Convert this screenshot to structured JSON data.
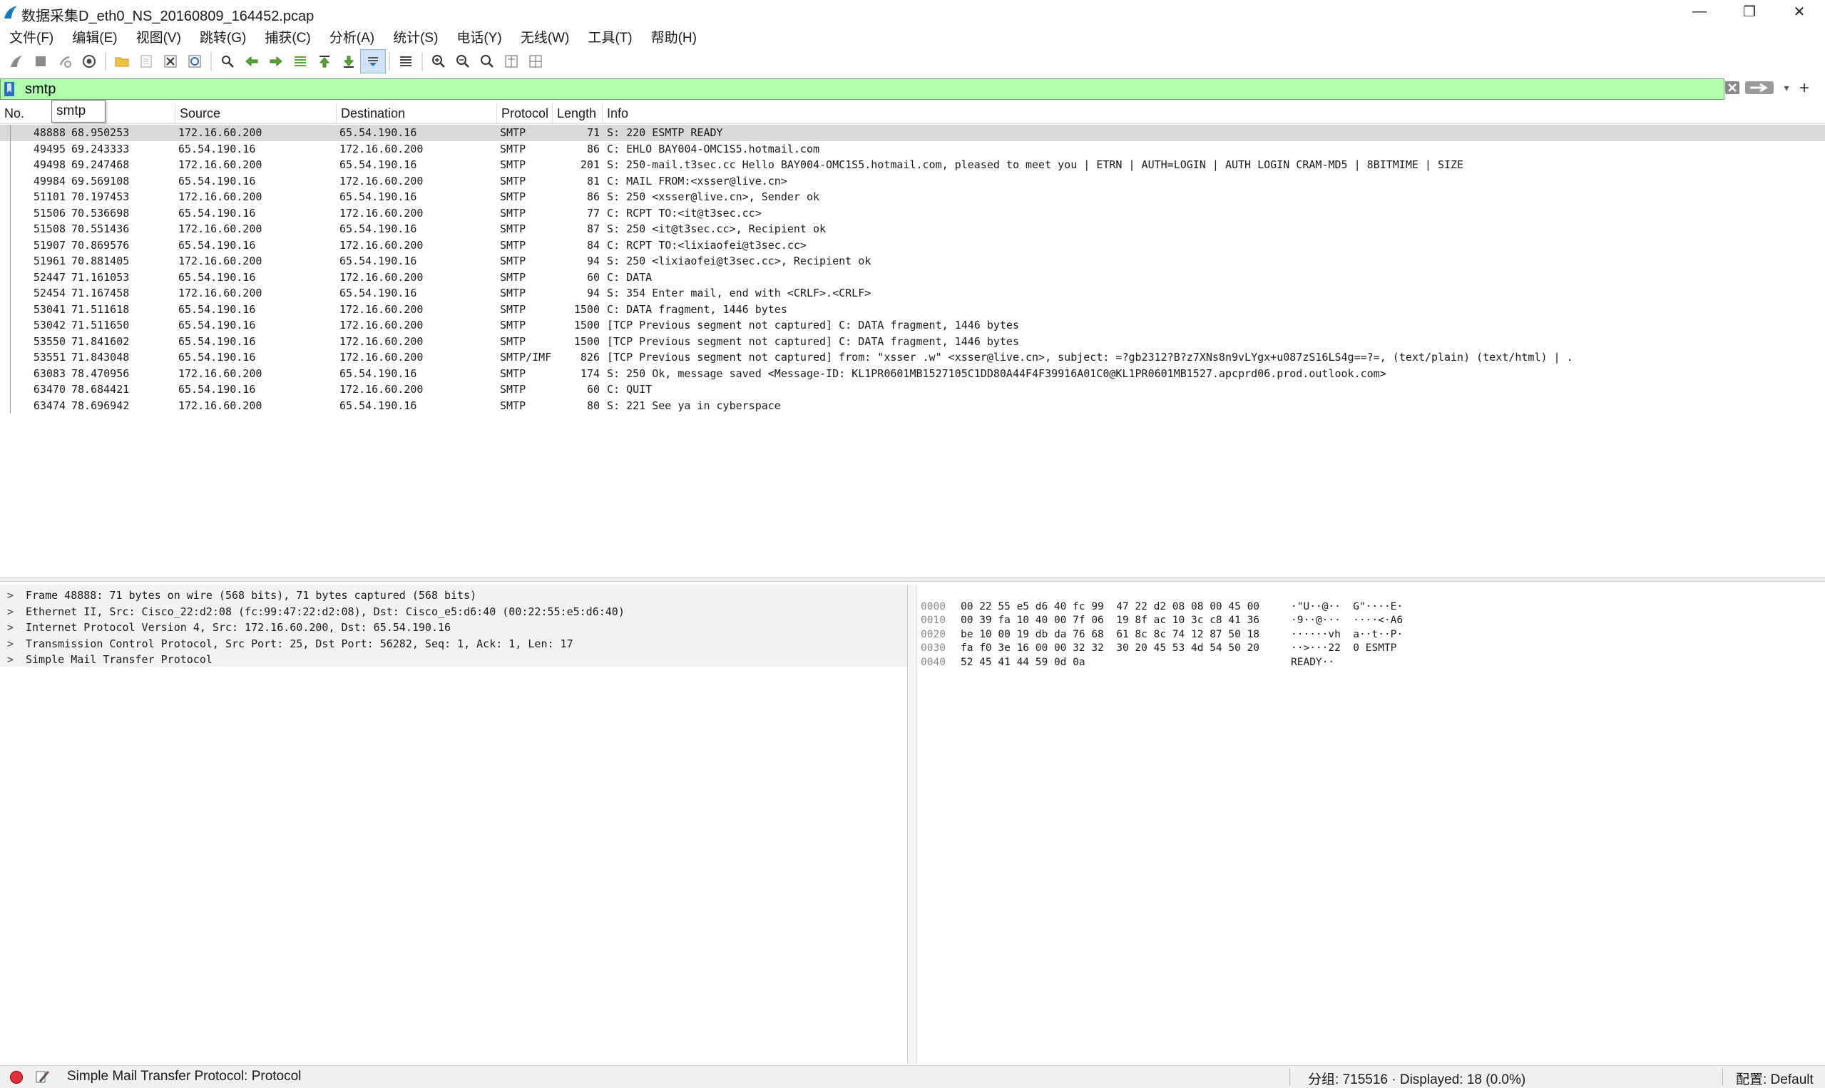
{
  "window": {
    "title": "数据采集D_eth0_NS_20160809_164452.pcap",
    "minimize": "—",
    "maximize": "❐",
    "close": "✕"
  },
  "menu": [
    "文件(F)",
    "编辑(E)",
    "视图(V)",
    "跳转(G)",
    "捕获(C)",
    "分析(A)",
    "统计(S)",
    "电话(Y)",
    "无线(W)",
    "工具(T)",
    "帮助(H)"
  ],
  "filter": {
    "value": "smtp",
    "autocomplete": "smtp",
    "add": "+",
    "dropdown": "▾"
  },
  "columns": [
    "No.",
    "Time",
    "Source",
    "Destination",
    "Protocol",
    "Length",
    "Info"
  ],
  "packets": [
    {
      "no": "48888",
      "time": "68.950253",
      "src": "172.16.60.200",
      "dst": "65.54.190.16",
      "proto": "SMTP",
      "len": "71",
      "info": "S: 220 ESMTP READY"
    },
    {
      "no": "49495",
      "time": "69.243333",
      "src": "65.54.190.16",
      "dst": "172.16.60.200",
      "proto": "SMTP",
      "len": "86",
      "info": "C: EHLO BAY004-OMC1S5.hotmail.com"
    },
    {
      "no": "49498",
      "time": "69.247468",
      "src": "172.16.60.200",
      "dst": "65.54.190.16",
      "proto": "SMTP",
      "len": "201",
      "info": "S: 250-mail.t3sec.cc Hello BAY004-OMC1S5.hotmail.com, pleased to meet you | ETRN | AUTH=LOGIN | AUTH LOGIN CRAM-MD5 | 8BITMIME | SIZE"
    },
    {
      "no": "49984",
      "time": "69.569108",
      "src": "65.54.190.16",
      "dst": "172.16.60.200",
      "proto": "SMTP",
      "len": "81",
      "info": "C: MAIL FROM:<xsser@live.cn>"
    },
    {
      "no": "51101",
      "time": "70.197453",
      "src": "172.16.60.200",
      "dst": "65.54.190.16",
      "proto": "SMTP",
      "len": "86",
      "info": "S: 250 <xsser@live.cn>, Sender ok"
    },
    {
      "no": "51506",
      "time": "70.536698",
      "src": "65.54.190.16",
      "dst": "172.16.60.200",
      "proto": "SMTP",
      "len": "77",
      "info": "C: RCPT TO:<it@t3sec.cc>"
    },
    {
      "no": "51508",
      "time": "70.551436",
      "src": "172.16.60.200",
      "dst": "65.54.190.16",
      "proto": "SMTP",
      "len": "87",
      "info": "S: 250 <it@t3sec.cc>, Recipient ok"
    },
    {
      "no": "51907",
      "time": "70.869576",
      "src": "65.54.190.16",
      "dst": "172.16.60.200",
      "proto": "SMTP",
      "len": "84",
      "info": "C: RCPT TO:<lixiaofei@t3sec.cc>"
    },
    {
      "no": "51961",
      "time": "70.881405",
      "src": "172.16.60.200",
      "dst": "65.54.190.16",
      "proto": "SMTP",
      "len": "94",
      "info": "S: 250 <lixiaofei@t3sec.cc>, Recipient ok"
    },
    {
      "no": "52447",
      "time": "71.161053",
      "src": "65.54.190.16",
      "dst": "172.16.60.200",
      "proto": "SMTP",
      "len": "60",
      "info": "C: DATA"
    },
    {
      "no": "52454",
      "time": "71.167458",
      "src": "172.16.60.200",
      "dst": "65.54.190.16",
      "proto": "SMTP",
      "len": "94",
      "info": "S: 354 Enter mail, end with <CRLF>.<CRLF>"
    },
    {
      "no": "53041",
      "time": "71.511618",
      "src": "65.54.190.16",
      "dst": "172.16.60.200",
      "proto": "SMTP",
      "len": "1500",
      "info": "C: DATA fragment, 1446 bytes"
    },
    {
      "no": "53042",
      "time": "71.511650",
      "src": "65.54.190.16",
      "dst": "172.16.60.200",
      "proto": "SMTP",
      "len": "1500",
      "info": "[TCP Previous segment not captured] C: DATA fragment, 1446 bytes"
    },
    {
      "no": "53550",
      "time": "71.841602",
      "src": "65.54.190.16",
      "dst": "172.16.60.200",
      "proto": "SMTP",
      "len": "1500",
      "info": "[TCP Previous segment not captured] C: DATA fragment, 1446 bytes"
    },
    {
      "no": "53551",
      "time": "71.843048",
      "src": "65.54.190.16",
      "dst": "172.16.60.200",
      "proto": "SMTP/IMF",
      "len": "826",
      "info": "[TCP Previous segment not captured] from: \"xsser .w\" <xsser@live.cn>, subject: =?gb2312?B?z7XNs8n9vLYgx+u087zS16LS4g==?=,  (text/plain) (text/html) | ."
    },
    {
      "no": "63083",
      "time": "78.470956",
      "src": "172.16.60.200",
      "dst": "65.54.190.16",
      "proto": "SMTP",
      "len": "174",
      "info": "S: 250 Ok, message saved <Message-ID: KL1PR0601MB1527105C1DD80A44F4F39916A01C0@KL1PR0601MB1527.apcprd06.prod.outlook.com>"
    },
    {
      "no": "63470",
      "time": "78.684421",
      "src": "65.54.190.16",
      "dst": "172.16.60.200",
      "proto": "SMTP",
      "len": "60",
      "info": "C: QUIT"
    },
    {
      "no": "63474",
      "time": "78.696942",
      "src": "172.16.60.200",
      "dst": "65.54.190.16",
      "proto": "SMTP",
      "len": "80",
      "info": "S: 221 See ya in cyberspace"
    }
  ],
  "details": [
    "Frame 48888: 71 bytes on wire (568 bits), 71 bytes captured (568 bits)",
    "Ethernet II, Src: Cisco_22:d2:08 (fc:99:47:22:d2:08), Dst: Cisco_e5:d6:40 (00:22:55:e5:d6:40)",
    "Internet Protocol Version 4, Src: 172.16.60.200, Dst: 65.54.190.16",
    "Transmission Control Protocol, Src Port: 25, Dst Port: 56282, Seq: 1, Ack: 1, Len: 17",
    "Simple Mail Transfer Protocol"
  ],
  "bytes": [
    {
      "offset": "0000",
      "hex": "00 22 55 e5 d6 40 fc 99  47 22 d2 08 08 00 45 00",
      "ascii": "·\"U··@··  G\"····E·"
    },
    {
      "offset": "0010",
      "hex": "00 39 fa 10 40 00 7f 06  19 8f ac 10 3c c8 41 36",
      "ascii": "·9··@···  ····<·A6"
    },
    {
      "offset": "0020",
      "hex": "be 10 00 19 db da 76 68  61 8c 8c 74 12 87 50 18",
      "ascii": "······vh  a··t··P·"
    },
    {
      "offset": "0030",
      "hex": "fa f0 3e 16 00 00 32 32  30 20 45 53 4d 54 50 20",
      "ascii": "··>···22  0 ESMTP "
    },
    {
      "offset": "0040",
      "hex": "52 45 41 44 59 0d 0a",
      "ascii": "READY··"
    }
  ],
  "status": {
    "text": "Simple Mail Transfer Protocol: Protocol",
    "packets": "分组: 715516 · Displayed: 18 (0.0%)",
    "profile": "配置: Default"
  },
  "colors": {
    "filter_valid": "#afffaf",
    "selected_row": "#d9d9d9",
    "status_red": "#e0303a"
  }
}
